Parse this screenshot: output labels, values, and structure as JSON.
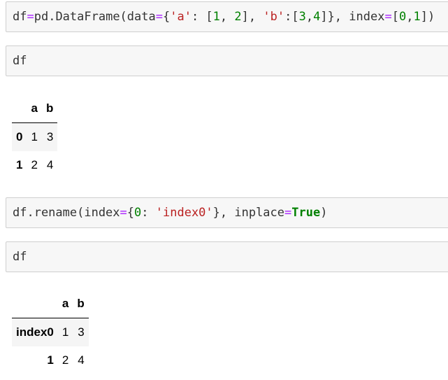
{
  "cells": [
    {
      "tokens": [
        {
          "t": "df",
          "c": "name"
        },
        {
          "t": "=",
          "c": "op"
        },
        {
          "t": "pd.DataFrame(data",
          "c": "name"
        },
        {
          "t": "=",
          "c": "op"
        },
        {
          "t": "{",
          "c": "punct"
        },
        {
          "t": "'a'",
          "c": "str"
        },
        {
          "t": ": [",
          "c": "punct"
        },
        {
          "t": "1",
          "c": "num"
        },
        {
          "t": ", ",
          "c": "punct"
        },
        {
          "t": "2",
          "c": "num"
        },
        {
          "t": "], ",
          "c": "punct"
        },
        {
          "t": "'b'",
          "c": "str"
        },
        {
          "t": ":[",
          "c": "punct"
        },
        {
          "t": "3",
          "c": "num"
        },
        {
          "t": ",",
          "c": "punct"
        },
        {
          "t": "4",
          "c": "num"
        },
        {
          "t": "]}, index",
          "c": "punct"
        },
        {
          "t": "=",
          "c": "op"
        },
        {
          "t": "[",
          "c": "punct"
        },
        {
          "t": "0",
          "c": "num"
        },
        {
          "t": ",",
          "c": "punct"
        },
        {
          "t": "1",
          "c": "num"
        },
        {
          "t": "])",
          "c": "punct"
        }
      ]
    },
    {
      "tokens": [
        {
          "t": "df",
          "c": "name"
        }
      ]
    },
    {
      "tokens": [
        {
          "t": "df.rename(index",
          "c": "name"
        },
        {
          "t": "=",
          "c": "op"
        },
        {
          "t": "{",
          "c": "punct"
        },
        {
          "t": "0",
          "c": "num"
        },
        {
          "t": ": ",
          "c": "punct"
        },
        {
          "t": "'index0'",
          "c": "str"
        },
        {
          "t": "}, inplace",
          "c": "punct"
        },
        {
          "t": "=",
          "c": "op"
        },
        {
          "t": "True",
          "c": "kw"
        },
        {
          "t": ")",
          "c": "punct"
        }
      ]
    },
    {
      "tokens": [
        {
          "t": "df",
          "c": "name"
        }
      ]
    }
  ],
  "outputs": [
    {
      "columns": [
        "",
        "a",
        "b"
      ],
      "rows": [
        {
          "index": "0",
          "values": [
            "1",
            "3"
          ]
        },
        {
          "index": "1",
          "values": [
            "2",
            "4"
          ]
        }
      ]
    },
    {
      "columns": [
        "",
        "a",
        "b"
      ],
      "rows": [
        {
          "index": "index0",
          "values": [
            "1",
            "3"
          ]
        },
        {
          "index": "1",
          "values": [
            "2",
            "4"
          ]
        }
      ]
    }
  ]
}
